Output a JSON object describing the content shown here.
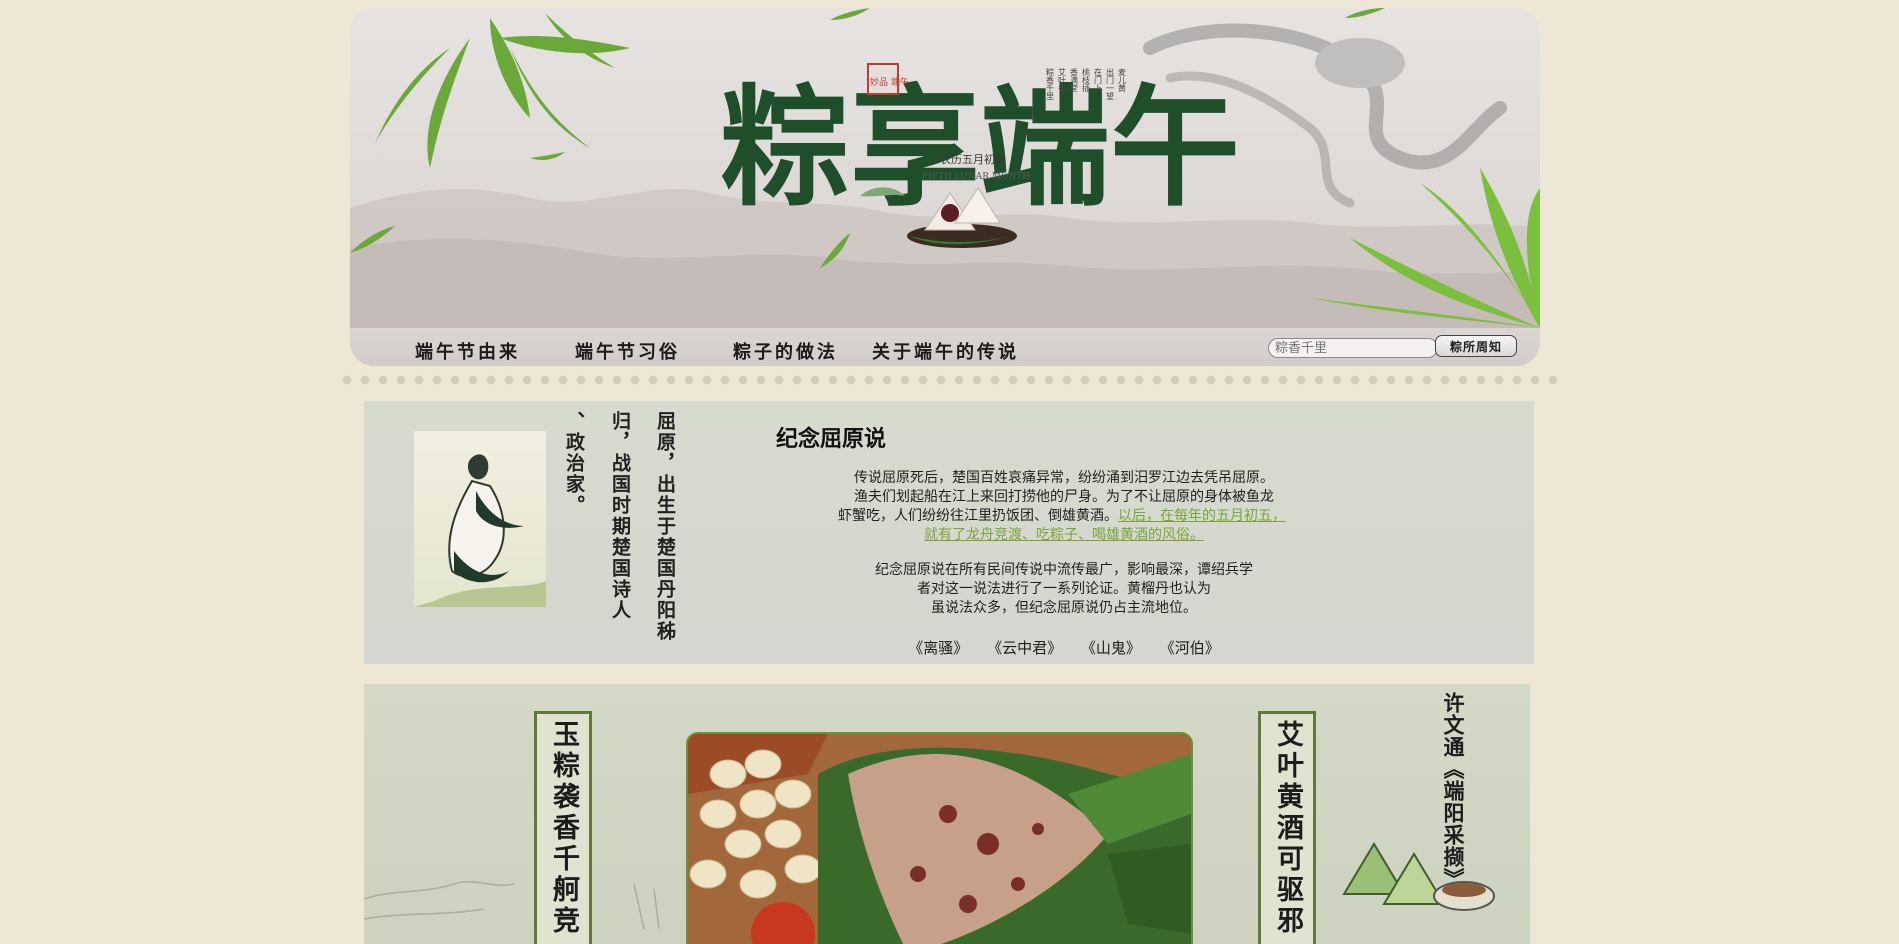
{
  "header": {
    "title": "粽享端午",
    "seal_text": "妙品 端午",
    "lunar_date": "农历五月初五",
    "lunar_en": "FIFTH LUNAR MONTH",
    "poem_lines": [
      "粽香千里",
      "艾叶香",
      "香满堂",
      "桃枝插",
      "在门上",
      "出门一望",
      "麦儿黄"
    ],
    "nav": [
      {
        "label": "端午节由来"
      },
      {
        "label": "端午节习俗"
      },
      {
        "label": "粽子的做法"
      },
      {
        "label": "关于端午的传说"
      }
    ],
    "search": {
      "placeholder": "粽香千里",
      "button_label": "粽所周知"
    }
  },
  "section1": {
    "vertical_columns": [
      "屈原，出生于楚国丹阳秭",
      "归，战国时期楚国诗人",
      "、政治家。"
    ],
    "title": "纪念屈原说",
    "para1_line1": "传说屈原死后，楚国百姓哀痛异常，纷纷涌到汨罗江边去凭吊屈原。",
    "para1_line2": "渔夫们划起船在江上来回打捞他的尸身。为了不让屈原的身体被鱼龙",
    "para1_line3": "虾蟹吃，人们纷纷往江里扔饭团、倒雄黄酒。",
    "para1_link_a": "以后，在每年的五月初五，",
    "para1_link_b": "就有了龙舟竞渡、吃粽子、喝雄黄酒的风俗。",
    "para2_line1": "纪念屈原说在所有民间传说中流传最广，影响最深，谭绍兵学",
    "para2_line2": "者对这一说法进行了一系列论证。黄榴丹也认为",
    "para2_line3": "虽说法众多，但纪念屈原说仍占主流地位。",
    "works": [
      "《离骚》",
      "《云中君》",
      "《山鬼》",
      "《河伯》"
    ]
  },
  "section2": {
    "couplet_left": "玉粽袭香千舸竞",
    "couplet_right": "艾叶黄酒可驱邪",
    "quote_vertical": "许文通《端阳采撷》"
  }
}
